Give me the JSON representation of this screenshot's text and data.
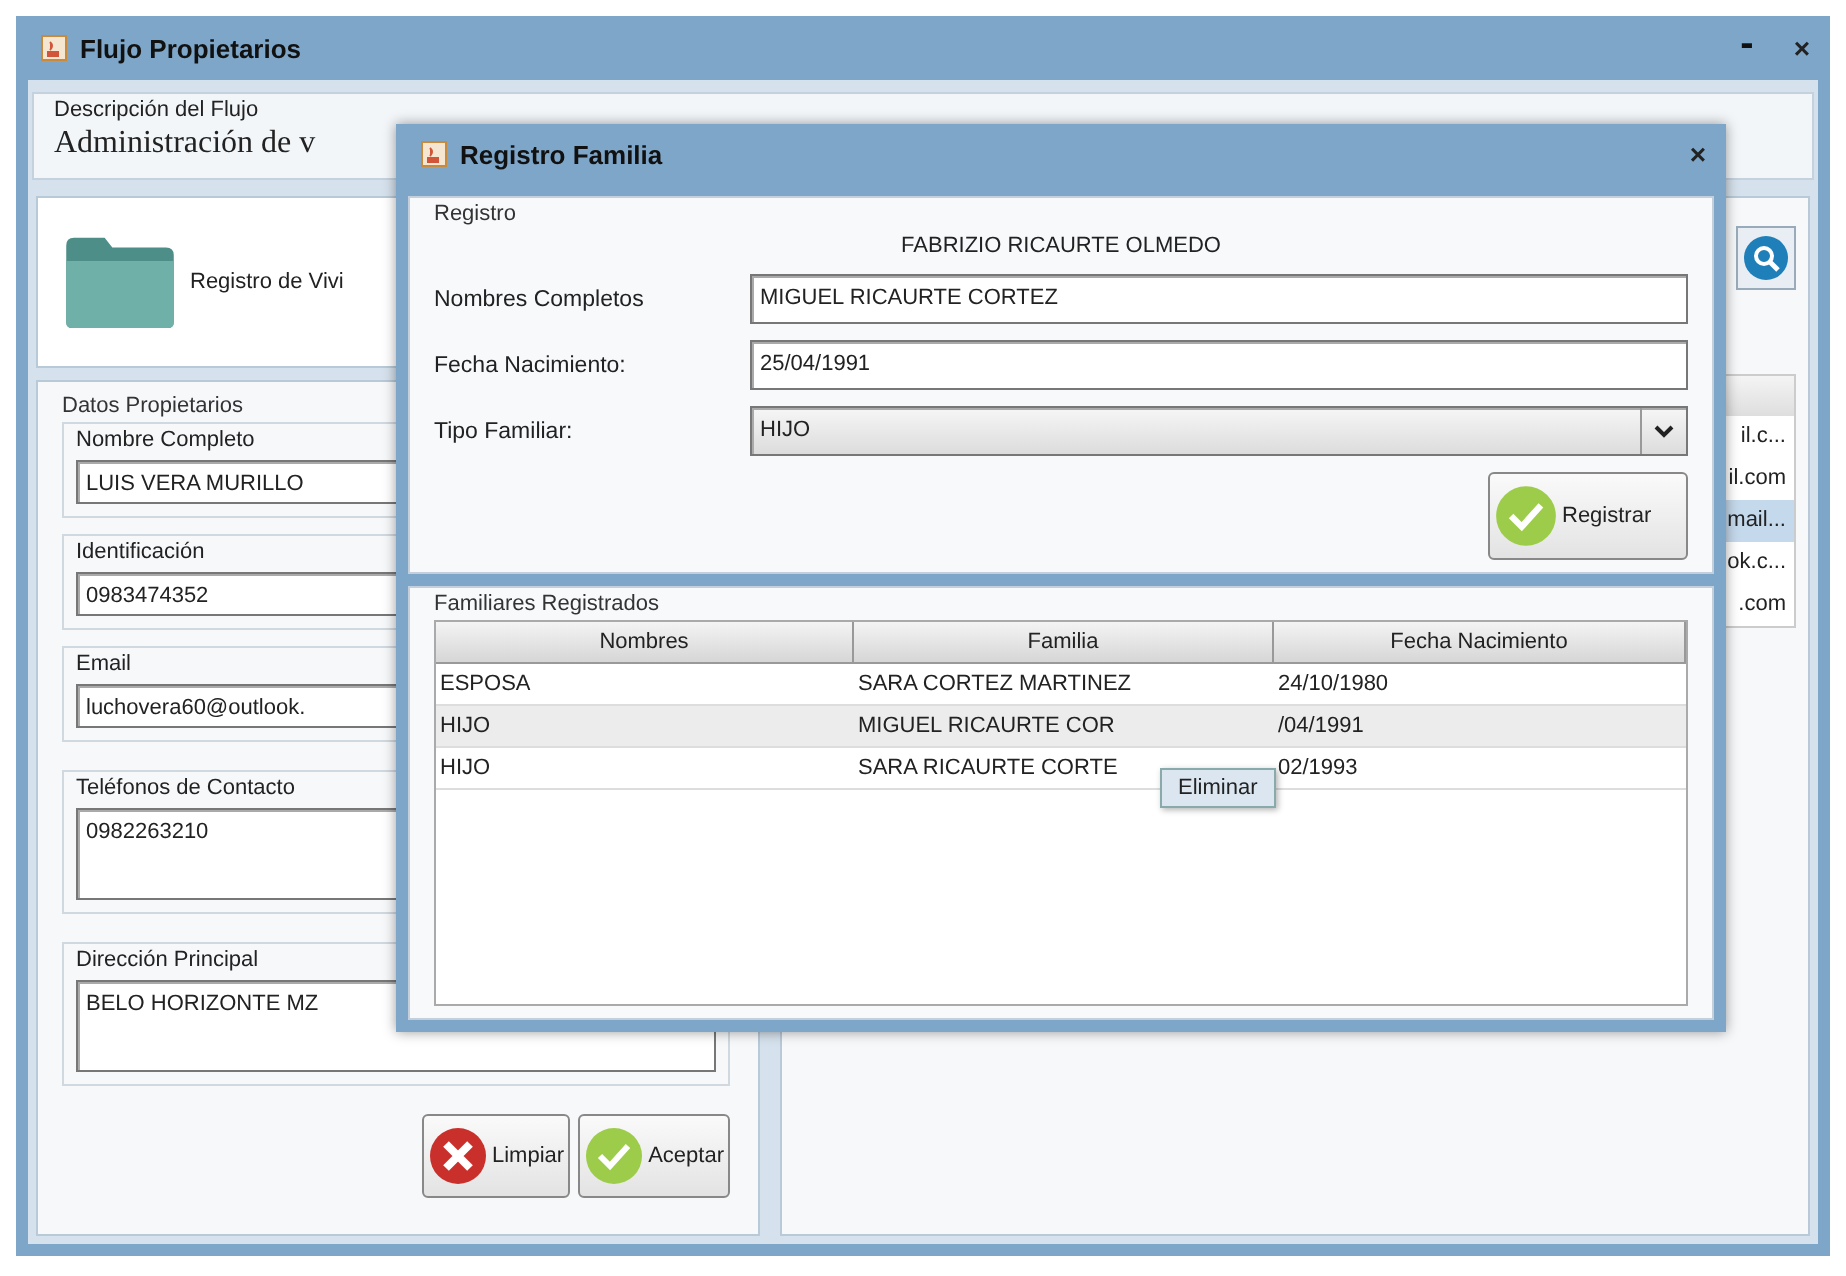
{
  "main_window": {
    "title": "Flujo Propietarios",
    "controls": [
      {
        "label": "-",
        "kind": "minimize"
      },
      {
        "label": "×",
        "kind": "close"
      }
    ]
  },
  "flow_description": {
    "label": "Descripción del Flujo",
    "value": "Administración de v"
  },
  "module_button": {
    "label": "Registro de Vivi"
  },
  "owner_form": {
    "title": "Datos Propietarios",
    "fields": [
      {
        "label": "Nombre Completo",
        "value": "LUIS VERA MURILLO",
        "kind": "line"
      },
      {
        "label": "Identificación",
        "value": "0983474352",
        "kind": "line"
      },
      {
        "label": "Email",
        "value": "luchovera60@outlook.",
        "kind": "line"
      },
      {
        "label": "Teléfonos de Contacto",
        "value": "0982263210",
        "kind": "area"
      },
      {
        "label": "Dirección Principal",
        "value": "BELO HORIZONTE MZ",
        "kind": "area"
      }
    ],
    "buttons": [
      {
        "label": "Limpiar",
        "kind": "clear"
      },
      {
        "label": "Aceptar",
        "kind": "accept"
      }
    ]
  },
  "owners_table": {
    "rows": [
      {
        "cell": "il.c...",
        "selected": false
      },
      {
        "cell": "il.com",
        "selected": false
      },
      {
        "cell": "mail...",
        "selected": true
      },
      {
        "cell": "ok.c...",
        "selected": false
      },
      {
        "cell": ".com",
        "selected": false
      }
    ]
  },
  "dialog": {
    "title": "Registro Familia",
    "close": "×",
    "group": "Registro",
    "owner": "FABRIZIO RICAURTE OLMEDO",
    "fields": [
      {
        "label": "Nombres Completos",
        "value": "MIGUEL RICAURTE CORTEZ",
        "kind": "text"
      },
      {
        "label": "Fecha Nacimiento:",
        "value": "25/04/1991",
        "kind": "text"
      },
      {
        "label": "Tipo Familiar:",
        "value": "HIJO",
        "kind": "select"
      }
    ],
    "submit": "Registrar",
    "table": {
      "title": "Familiares Registrados",
      "columns": [
        "Nombres",
        "Familia",
        "Fecha Nacimiento"
      ],
      "rows": [
        {
          "cells": [
            "ESPOSA",
            "SARA CORTEZ MARTINEZ",
            "24/10/1980"
          ],
          "selected": false
        },
        {
          "cells": [
            "HIJO",
            "MIGUEL RICAURTE COR",
            "/04/1991"
          ],
          "selected": true
        },
        {
          "cells": [
            "HIJO",
            "SARA RICAURTE CORTE",
            "02/1993"
          ],
          "selected": false
        }
      ]
    }
  },
  "context_menu": {
    "items": [
      "Eliminar"
    ]
  }
}
